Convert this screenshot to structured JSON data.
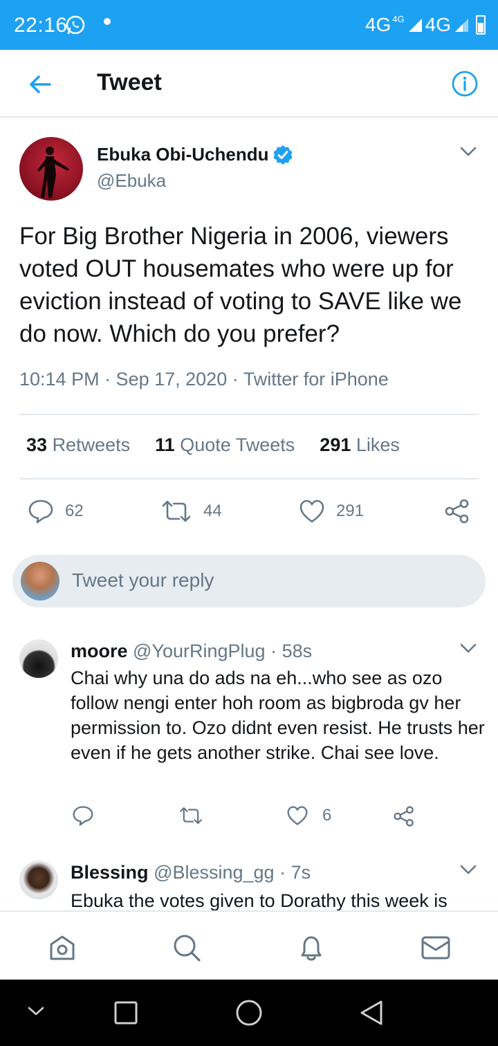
{
  "status_bar": {
    "time": "22:16",
    "network_1": "4G",
    "network_1_sup": "4G",
    "network_2": "4G"
  },
  "header": {
    "title": "Tweet"
  },
  "tweet": {
    "author_name": "Ebuka Obi-Uchendu",
    "author_handle": "@Ebuka",
    "text": "For Big Brother Nigeria in 2006, viewers voted OUT housemates who were up for eviction instead of voting to SAVE like we do now. Which do you prefer?",
    "meta": "10:14 PM · Sep 17, 2020 · Twitter for iPhone",
    "stats": {
      "retweets_count": "33",
      "retweets_label": "Retweets",
      "quotes_count": "11",
      "quotes_label": "Quote Tweets",
      "likes_count": "291",
      "likes_label": "Likes"
    },
    "actions": {
      "replies": "62",
      "retweets": "44",
      "likes": "291"
    }
  },
  "reply_box": {
    "placeholder": "Tweet your reply"
  },
  "replies": [
    {
      "name": "moore",
      "handle": "@YourRingPlug",
      "time": "· 58s",
      "text": "Chai why una do ads na eh...who see as ozo follow nengi enter hoh room as bigbroda gv her permission to. Ozo didnt even resist. He trusts her even if he gets another strike. Chai see love.",
      "likes": "6"
    },
    {
      "name": "Blessing",
      "handle": "@Blessing_gg",
      "time": "· 7s",
      "text": "Ebuka the votes given to Dorathy this week is"
    }
  ],
  "colors": {
    "accent": "#1da1f2",
    "secondary_text": "#657786",
    "border": "#e1e8ed"
  },
  "icons": {
    "header": [
      "back-arrow-icon",
      "info-icon"
    ],
    "actions": [
      "reply-icon",
      "retweet-icon",
      "like-icon",
      "share-icon"
    ],
    "bottom_nav": [
      "home-icon",
      "search-icon",
      "notifications-icon",
      "messages-icon"
    ],
    "system_nav": [
      "collapse-icon",
      "recents-icon",
      "home-circle-icon",
      "back-triangle-icon"
    ]
  }
}
